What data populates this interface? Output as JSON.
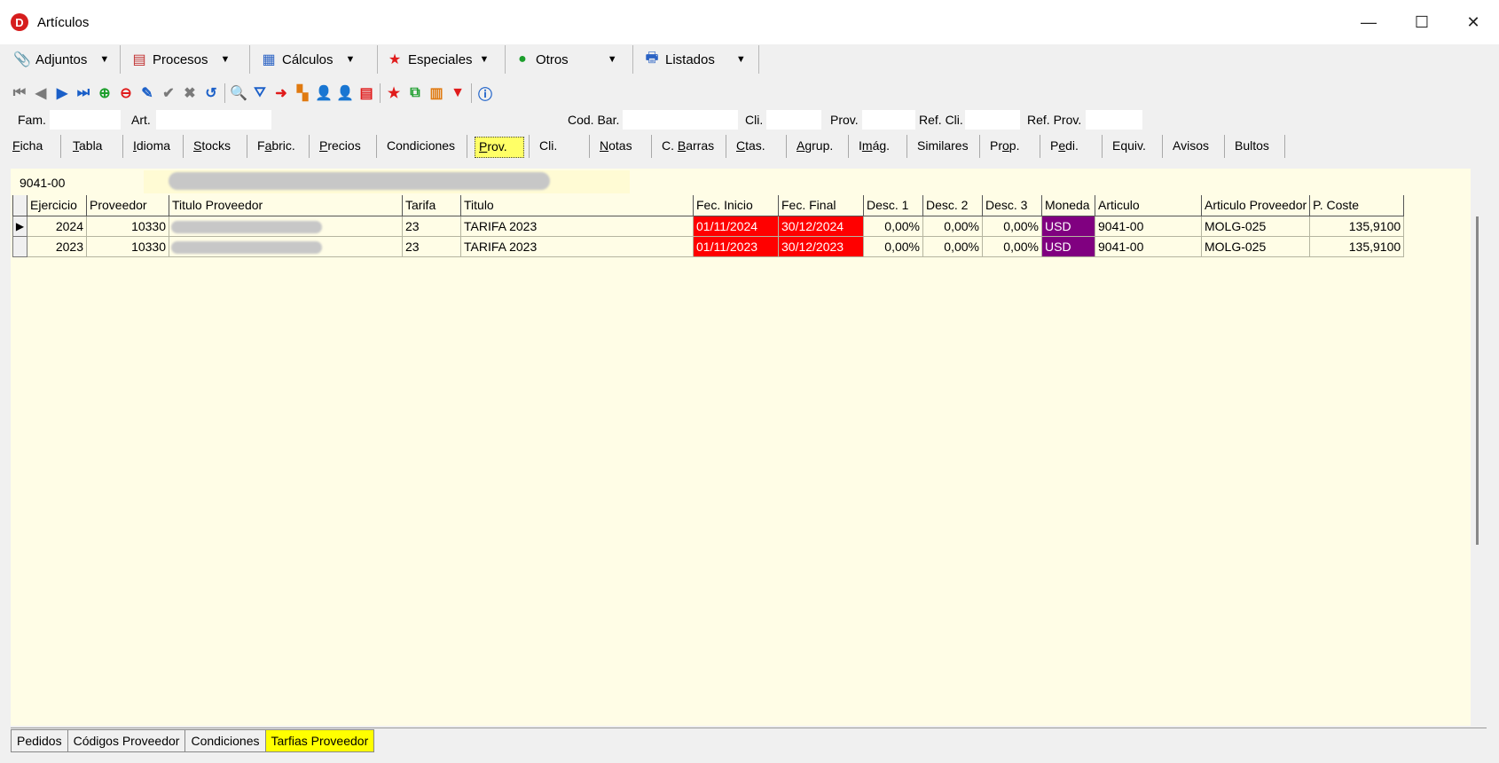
{
  "window": {
    "title": "Artículos",
    "app_icon_letter": "D",
    "minimize": "—",
    "maximize": "☐",
    "close": "✕"
  },
  "menu": [
    {
      "label": "Adjuntos",
      "icon": "paperclip-icon"
    },
    {
      "label": "Procesos",
      "icon": "process-icon"
    },
    {
      "label": "Cálculos",
      "icon": "calculator-icon"
    },
    {
      "label": "Especiales",
      "icon": "star-icon"
    },
    {
      "label": "Otros",
      "icon": "more-icon"
    },
    {
      "label": "Listados",
      "icon": "printer-icon"
    }
  ],
  "filters": {
    "fam_label": "Fam.",
    "art_label": "Art.",
    "codbar_label": "Cod. Bar.",
    "cli_label": "Cli.",
    "prov_label": "Prov.",
    "refcli_label": "Ref. Cli.",
    "refprov_label": "Ref. Prov."
  },
  "tabs": [
    {
      "label": "Ficha",
      "u": "F"
    },
    {
      "label": "Tabla",
      "u": "T"
    },
    {
      "label": "Idioma",
      "u": "I"
    },
    {
      "label": "Stocks",
      "u": "S"
    },
    {
      "label": "Fabric.",
      "u": "a"
    },
    {
      "label": "Precios",
      "u": "P"
    },
    {
      "label": "Condiciones",
      "u": ""
    },
    {
      "label": "Prov.",
      "u": "P"
    },
    {
      "label": "Cli.",
      "u": ""
    },
    {
      "label": "Notas",
      "u": "N"
    },
    {
      "label": "C. Barras",
      "u": "B"
    },
    {
      "label": "Ctas.",
      "u": "C"
    },
    {
      "label": "Agrup.",
      "u": "A"
    },
    {
      "label": "Imág.",
      "u": "m"
    },
    {
      "label": "Similares",
      "u": ""
    },
    {
      "label": "Prop.",
      "u": "o"
    },
    {
      "label": "Pedi.",
      "u": "e"
    },
    {
      "label": "Equiv.",
      "u": ""
    },
    {
      "label": "Avisos",
      "u": ""
    },
    {
      "label": "Bultos",
      "u": ""
    }
  ],
  "active_tab": "Prov.",
  "article": {
    "code": "9041-00"
  },
  "grid": {
    "headers": [
      "Ejercicio",
      "Proveedor",
      "Titulo Proveedor",
      "Tarifa",
      "Titulo",
      "Fec. Inicio",
      "Fec. Final",
      "Desc. 1",
      "Desc. 2",
      "Desc. 3",
      "Moneda",
      "Articulo",
      "Articulo Proveedor",
      "P. Coste"
    ],
    "rows": [
      {
        "ejercicio": "2024",
        "proveedor": "10330",
        "tarifa": "23",
        "titulo": "TARIFA 2023",
        "fec_inicio": "01/11/2024",
        "fec_final": "30/12/2024",
        "desc1": "0,00%",
        "desc2": "0,00%",
        "desc3": "0,00%",
        "moneda": "USD",
        "articulo": "9041-00",
        "articulo_prov": "MOLG-025",
        "p_coste": "135,9100"
      },
      {
        "ejercicio": "2023",
        "proveedor": "10330",
        "tarifa": "23",
        "titulo": "TARIFA 2023",
        "fec_inicio": "01/11/2023",
        "fec_final": "30/12/2023",
        "desc1": "0,00%",
        "desc2": "0,00%",
        "desc3": "0,00%",
        "moneda": "USD",
        "articulo": "9041-00",
        "articulo_prov": "MOLG-025",
        "p_coste": "135,9100"
      }
    ]
  },
  "bottom_tabs": [
    "Pedidos",
    "Códigos Proveedor",
    "Condiciones",
    "Tarfias Proveedor"
  ],
  "bottom_active": "Tarfias Proveedor",
  "colors": {
    "date_bg": "#ff0000",
    "currency_bg": "#800080",
    "panel_bg": "#fffde6",
    "active_tab_bg": "#ffff66"
  }
}
